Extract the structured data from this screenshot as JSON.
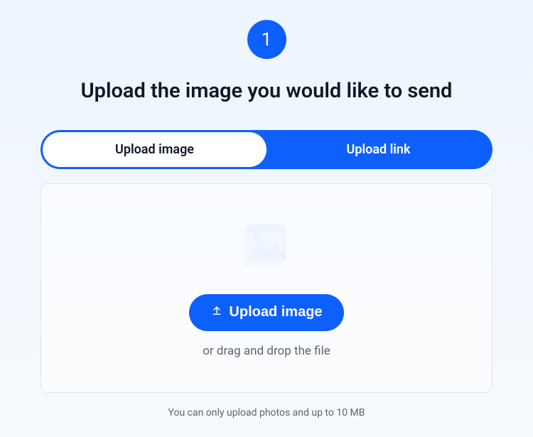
{
  "step": {
    "number": "1",
    "title": "Upload the image you would like to send"
  },
  "tabs": {
    "upload_image": "Upload image",
    "upload_link": "Upload link"
  },
  "dropzone": {
    "button_label": "Upload image",
    "dnd_text": "or drag and drop the file"
  },
  "hint": "You can only upload photos and up to 10 MB",
  "icons": {
    "upload": "upload-icon",
    "image_placeholder": "image-placeholder-icon"
  },
  "colors": {
    "accent": "#0e60fc",
    "text_primary": "#101828",
    "text_secondary": "#5b6472"
  }
}
